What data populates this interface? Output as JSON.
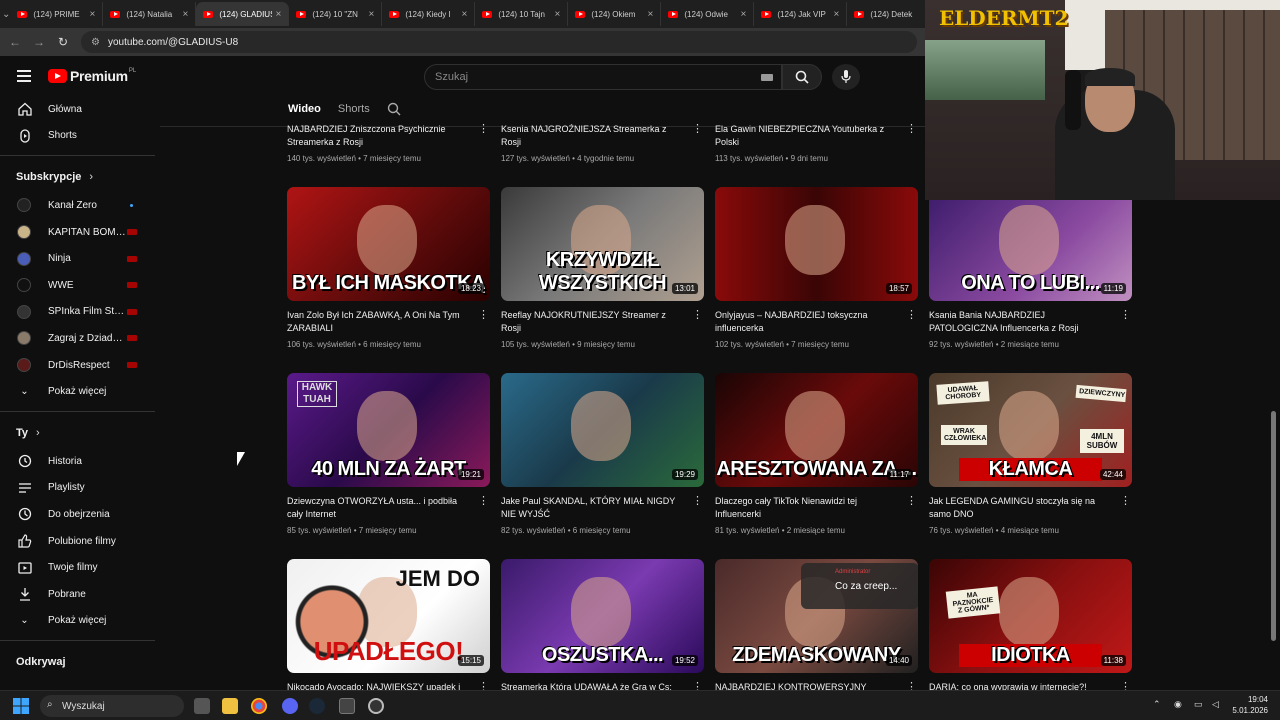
{
  "browser": {
    "tabs": [
      {
        "label": "(124) PRIME",
        "active": false
      },
      {
        "label": "(124) Natalia",
        "active": false
      },
      {
        "label": "(124) GLADIUS",
        "active": true
      },
      {
        "label": "(124) 10 \"ZN",
        "active": false
      },
      {
        "label": "(124) Kiedy I",
        "active": false
      },
      {
        "label": "(124) 10 Tajn",
        "active": false
      },
      {
        "label": "(124) Okiem",
        "active": false
      },
      {
        "label": "(124) Odwie",
        "active": false
      },
      {
        "label": "(124) Jak VIP",
        "active": false
      },
      {
        "label": "(124) Detek",
        "active": false
      }
    ],
    "url": "youtube.com/@GLADIUS-U8"
  },
  "youtube": {
    "logo_text": "Premium",
    "logo_region": "PL",
    "search_placeholder": "Szukaj",
    "channel_tabs": [
      "Wideo",
      "Shorts"
    ]
  },
  "sidebar": {
    "main": [
      {
        "label": "Główna",
        "icon": "home-icon"
      },
      {
        "label": "Shorts",
        "icon": "shorts-icon"
      }
    ],
    "subs_heading": "Subskrypcje",
    "subs": [
      {
        "label": "Kanał Zero",
        "color": "#222",
        "badge": "dot"
      },
      {
        "label": "KAPITAN BOMB...",
        "color": "#c9b48a",
        "badge": "live"
      },
      {
        "label": "Ninja",
        "color": "#4a5db8",
        "badge": "live"
      },
      {
        "label": "WWE",
        "color": "#111",
        "badge": "live"
      },
      {
        "label": "SPInka Film Stud...",
        "color": "#333",
        "badge": "live"
      },
      {
        "label": "Zagraj z Dziadkie...",
        "color": "#8a7a6a",
        "badge": "live"
      },
      {
        "label": "DrDisRespect",
        "color": "#5a1a1a",
        "badge": "live"
      }
    ],
    "show_more": "Pokaż więcej",
    "you_heading": "Ty",
    "you": [
      {
        "label": "Historia",
        "icon": "history-icon"
      },
      {
        "label": "Playlisty",
        "icon": "playlist-icon"
      },
      {
        "label": "Do obejrzenia",
        "icon": "watch-later-icon"
      },
      {
        "label": "Polubione filmy",
        "icon": "like-icon"
      },
      {
        "label": "Twoje filmy",
        "icon": "your-videos-icon"
      },
      {
        "label": "Pobrane",
        "icon": "download-icon"
      }
    ],
    "show_more2": "Pokaż więcej",
    "explore_heading": "Odkrywaj"
  },
  "videos_top": [
    {
      "title": "NAJBARDZIEJ Zniszczona Psychicznie Streamerka z Rosji",
      "meta": "140 tys. wyświetleń • 7 miesięcy temu"
    },
    {
      "title": "Ksenia NAJGROŹNIEJSZA Streamerka z Rosji",
      "meta": "127 tys. wyświetleń • 4 tygodnie temu"
    },
    {
      "title": "Ela Gawin NIEBEZPIECZNA Youtuberka z Polski",
      "meta": "113 tys. wyświetleń • 9 dni temu"
    }
  ],
  "videos": [
    {
      "title": "Ivan Zolo Był Ich ZABAWKĄ, A Oni Na Tym ZARABIALI",
      "meta": "106 tys. wyświetleń • 6 miesięcy temu",
      "duration": "18:23",
      "overlay": "BYŁ ICH MASKOTKĄ",
      "bg": "linear-gradient(135deg,#b01414,#5a0a0a 60%,#2a0000)"
    },
    {
      "title": "Reeflay NAJOKRUTNIEJSZY Streamer z Rosji",
      "meta": "105 tys. wyświetleń • 9 miesięcy temu",
      "duration": "13:01",
      "overlay": "KRZYWDZIŁ WSZYSTKICH",
      "bg": "linear-gradient(135deg,#3a3a3a,#7a7a7a 50%,#b0a090)"
    },
    {
      "title": "Onlyjayus – NAJBARDZIEJ toksyczna influencerka",
      "meta": "102 tys. wyświetleń • 7 miesięcy temu",
      "duration": "18:57",
      "overlay": "",
      "bg": "linear-gradient(90deg,#8a0a0a,#3a0505 50%,#8a0a0a)"
    },
    {
      "title": "Ksania Bania NAJBARDZIEJ PATOLOGICZNA Influencerka z Rosji",
      "meta": "92 tys. wyświetleń • 2 miesiące temu",
      "duration": "11:19",
      "overlay": "ONA TO LUBI...",
      "bg": "linear-gradient(135deg,#3a1a6a,#8a4aa0 60%,#c090c0)"
    },
    {
      "title": "Dziewczyna OTWORZYŁA usta... i podbiła cały Internet",
      "meta": "85 tys. wyświetleń • 7 miesięcy temu",
      "duration": "19:21",
      "overlay": "40 MLN ZA ŻART",
      "bg": "linear-gradient(135deg,#5a1a8a,#2a0a4a 50%,#8a1a5a)"
    },
    {
      "title": "Jake Paul SKANDAL, KTÓRY MIAŁ NIGDY NIE WYJŚĆ",
      "meta": "82 tys. wyświetleń • 6 miesięcy temu",
      "duration": "19:29",
      "overlay": "",
      "bg": "linear-gradient(135deg,#2a6a8a,#1a3a4a 50%,#2a6a3a)"
    },
    {
      "title": "Dlaczego cały TikTok Nienawidzi tej Influencerki",
      "meta": "81 tys. wyświetleń • 2 miesiące temu",
      "duration": "11:17",
      "overlay": "ARESZTOWANA ZA ...",
      "bg": "linear-gradient(135deg,#1a0505,#6a0a0a 50%,#2a0505)"
    },
    {
      "title": "Jak LEGENDA GAMINGU stoczyła się na samo DNO",
      "meta": "76 tys. wyświetleń • 4 miesiące temu",
      "duration": "42:44",
      "overlay": "KŁAMCA",
      "bg": "linear-gradient(135deg,#4a3a2a,#6a5040 50%,#a02020)"
    },
    {
      "title": "Nikocado Avocado: NAJWIĘKSZY upadek i",
      "meta": "",
      "duration": "15:15",
      "overlay": "UPADŁEGO!",
      "bg": "linear-gradient(135deg,#f0f0f0,#ffffff 60%,#d0d0d0)"
    },
    {
      "title": "Streamerka Która UDAWAŁA że Gra w Cs:",
      "meta": "",
      "duration": "19:52",
      "overlay": "OSZUSTKA...",
      "bg": "linear-gradient(135deg,#3a1a6a,#7a3ab0 50%,#2a0a5a)"
    },
    {
      "title": "NAJBARDZIEJ KONTROWERSYJNY",
      "meta": "",
      "duration": "14:40",
      "overlay": "ZDEMASKOWANY",
      "bg": "linear-gradient(135deg,#4a2a2a,#7a4a40 50%,#202020)"
    },
    {
      "title": "DARIA: co ona wyprawia w internecie?!",
      "meta": "",
      "duration": "11:38",
      "overlay": "IDIOTKA",
      "bg": "linear-gradient(135deg,#3a0505,#8a1010 50%,#c01818)"
    }
  ],
  "thumb_extra": {
    "hawk": "HAWK TUAH",
    "jem": "JEM DO",
    "upadlego": "UPADŁEGO!",
    "chat_user": "Administrator",
    "chat_msg": "Co za creep...",
    "note1": "UDAWAŁ CHOROBY",
    "note2": "DZIEWCZYNY",
    "note3": "WRAK CZŁOWIEKA",
    "note4": "4MLN SUBÓW",
    "note5": "MA PAZNOKCIE Z GÓWN*"
  },
  "stream": {
    "logo": "ELDERMT2"
  },
  "taskbar": {
    "search": "Wyszukaj",
    "time": "19:04",
    "date": "5.01.2026"
  }
}
